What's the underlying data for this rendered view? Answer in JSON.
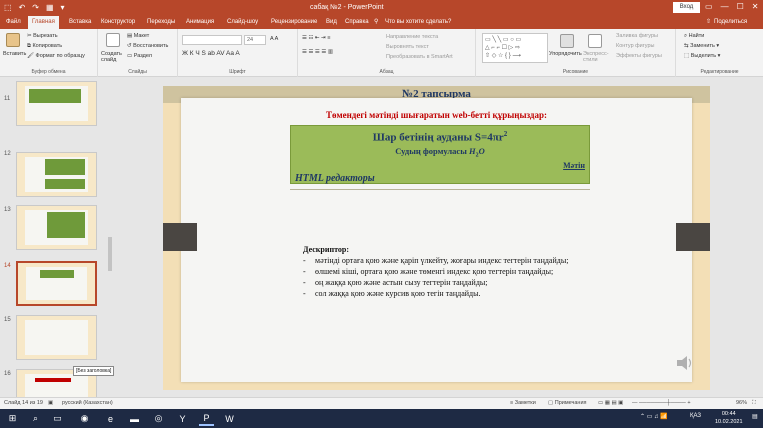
{
  "titlebar": {
    "qat": [
      "⬚",
      "↶",
      "↷",
      "▦",
      "▾"
    ],
    "title": "сабақ №2  -  PowerPoint",
    "signin": "Вход",
    "controls": [
      "▭",
      "—",
      "☐",
      "✕"
    ]
  },
  "tabs": {
    "items": [
      "Файл",
      "Главная",
      "Вставка",
      "Конструктор",
      "Переходы",
      "Анимация",
      "Слайд-шоу",
      "Рецензирование",
      "Вид",
      "Справка"
    ],
    "active": "Главная",
    "tell_me": "Что вы хотите сделать?",
    "share": "Поделиться"
  },
  "ribbon": {
    "clipboard": {
      "paste": "Вставить",
      "cut": "Вырезать",
      "copy": "Копировать",
      "format": "Формат по образцу",
      "label": "Буфер обмена"
    },
    "slides": {
      "new": "Создать слайд",
      "layout": "Макет",
      "reset": "Восстановить",
      "section": "Раздел",
      "label": "Слайды"
    },
    "font": {
      "size": "24",
      "label": "Шрифт"
    },
    "paragraph": {
      "dir": "Направление текста",
      "align": "Выровнять текст",
      "smartart": "Преобразовать в SmartArt",
      "label": "Абзац"
    },
    "drawing": {
      "arrange": "Упорядочить",
      "styles": "Экспресс-стили",
      "fill": "Заливка фигуры",
      "outline": "Контур фигуры",
      "effects": "Эффекты фигуры",
      "label": "Рисование"
    },
    "editing": {
      "find": "Найти",
      "replace": "Заменить",
      "select": "Выделить",
      "label": "Редактирование"
    }
  },
  "thumbnails": [
    {
      "num": "11"
    },
    {
      "num": "12"
    },
    {
      "num": "13"
    },
    {
      "num": "14",
      "active": true
    },
    {
      "num": "15"
    },
    {
      "num": "16"
    }
  ],
  "tooltip": "[Без заголовка]",
  "slide": {
    "title": "№2 тапсырма",
    "subtitle": "Төмендегі мәтінді шығаратын web-бетті құрыңыздар:",
    "formula_main": "Шар бетінің ауданы S=4πr",
    "formula_exp": "2",
    "formula_water_pre": "Судың формуласы ",
    "formula_water_h": "H",
    "formula_water_sub": "2",
    "formula_water_o": "O",
    "text_word": "Мәтін",
    "editors": "HTML редакторы",
    "descriptor_head": "Дескриптор:",
    "descriptors": [
      "мәтінді ортаға қою және қаріп үлкейту, жоғары индекс тегтерін таңдайды;",
      "өлшемі кіші, ортаға қою және төменгі индекс қою тегтерін таңдайды;",
      "оң жаққа қою және астын сызу тегтерін таңдайды;",
      "сол жаққа қою және курсив қою тегін таңдайды."
    ]
  },
  "status": {
    "slide_of": "Слайд 14 из 19",
    "language": "русский (Казахстан)",
    "notes": "Заметки",
    "comments": "Примечания",
    "zoom": "96%"
  },
  "taskbar": {
    "lang": "ҚАЗ",
    "time": "00:44",
    "date": "10.02.2021"
  }
}
